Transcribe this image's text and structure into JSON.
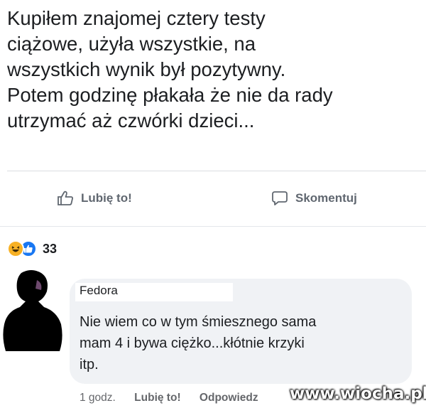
{
  "post": {
    "lines": [
      "Kupiłem znajomej cztery testy",
      "ciążowe, użyła wszystkie, na",
      "wszystkich wynik był pozytywny.",
      "Potem godzinę płakała że nie da rady",
      "utrzymać aż czwórki dzieci..."
    ]
  },
  "actions": {
    "like_label": "Lubię to!",
    "comment_label": "Skomentuj"
  },
  "reactions": {
    "icons": [
      "haha-icon",
      "like-icon"
    ],
    "count": "33"
  },
  "comment": {
    "author": "Fedora",
    "lines": [
      "Nie wiem co w tym śmiesznego sama",
      "mam 4 i bywa ciężko...kłótnie krzyki",
      "itp."
    ],
    "meta": {
      "time": "1 godz.",
      "like": "Lubię to!",
      "reply": "Odpowiedz"
    }
  },
  "watermark": "www.wiocha.pl",
  "colors": {
    "like_blue": "#1877f2",
    "haha_yellow": "#f7b125",
    "bubble_bg": "#f0f2f5",
    "muted_text": "#606770"
  }
}
